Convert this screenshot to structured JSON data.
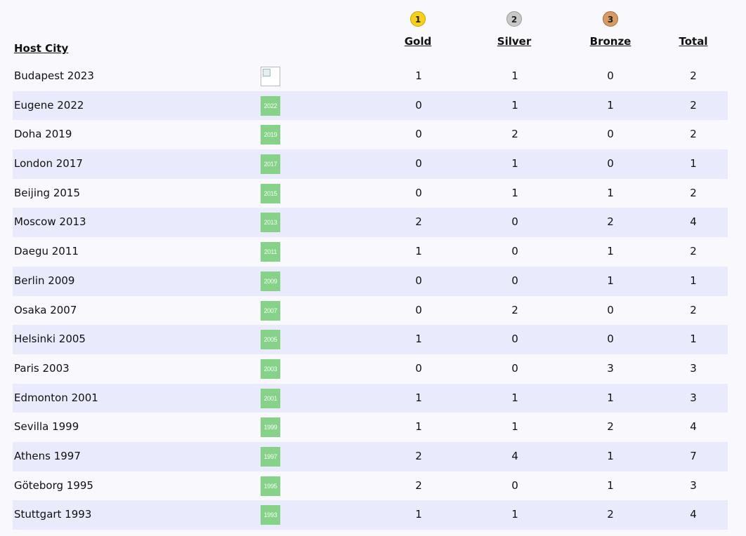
{
  "header": {
    "host_city": "Host City",
    "gold": "Gold",
    "silver": "Silver",
    "bronze": "Bronze",
    "total": "Total",
    "gold_rank": "1",
    "silver_rank": "2",
    "bronze_rank": "3"
  },
  "colors": {
    "gold": "#f6d01a",
    "silver": "#c8c8c8",
    "bronze": "#d69a64",
    "row_alt": "#e9eafb",
    "logo": "#86d289"
  },
  "rows": [
    {
      "city": "Budapest 2023",
      "logo": "",
      "logo_broken": true,
      "gold": "1",
      "silver": "1",
      "bronze": "0",
      "total": "2"
    },
    {
      "city": "Eugene 2022",
      "logo": "2022",
      "gold": "0",
      "silver": "1",
      "bronze": "1",
      "total": "2"
    },
    {
      "city": "Doha 2019",
      "logo": "2019",
      "gold": "0",
      "silver": "2",
      "bronze": "0",
      "total": "2"
    },
    {
      "city": "London 2017",
      "logo": "2017",
      "gold": "0",
      "silver": "1",
      "bronze": "0",
      "total": "1"
    },
    {
      "city": "Beijing 2015",
      "logo": "2015",
      "gold": "0",
      "silver": "1",
      "bronze": "1",
      "total": "2"
    },
    {
      "city": "Moscow 2013",
      "logo": "2013",
      "gold": "2",
      "silver": "0",
      "bronze": "2",
      "total": "4"
    },
    {
      "city": "Daegu 2011",
      "logo": "2011",
      "gold": "1",
      "silver": "0",
      "bronze": "1",
      "total": "2"
    },
    {
      "city": "Berlin 2009",
      "logo": "2009",
      "gold": "0",
      "silver": "0",
      "bronze": "1",
      "total": "1"
    },
    {
      "city": "Osaka 2007",
      "logo": "2007",
      "gold": "0",
      "silver": "2",
      "bronze": "0",
      "total": "2"
    },
    {
      "city": "Helsinki 2005",
      "logo": "2005",
      "gold": "1",
      "silver": "0",
      "bronze": "0",
      "total": "1"
    },
    {
      "city": "Paris 2003",
      "logo": "2003",
      "gold": "0",
      "silver": "0",
      "bronze": "3",
      "total": "3"
    },
    {
      "city": "Edmonton 2001",
      "logo": "2001",
      "gold": "1",
      "silver": "1",
      "bronze": "1",
      "total": "3"
    },
    {
      "city": "Sevilla 1999",
      "logo": "1999",
      "gold": "1",
      "silver": "1",
      "bronze": "2",
      "total": "4"
    },
    {
      "city": "Athens 1997",
      "logo": "1997",
      "gold": "2",
      "silver": "4",
      "bronze": "1",
      "total": "7"
    },
    {
      "city": "Göteborg 1995",
      "logo": "1995",
      "gold": "2",
      "silver": "0",
      "bronze": "1",
      "total": "3"
    },
    {
      "city": "Stuttgart 1993",
      "logo": "1993",
      "gold": "1",
      "silver": "1",
      "bronze": "2",
      "total": "4"
    }
  ]
}
